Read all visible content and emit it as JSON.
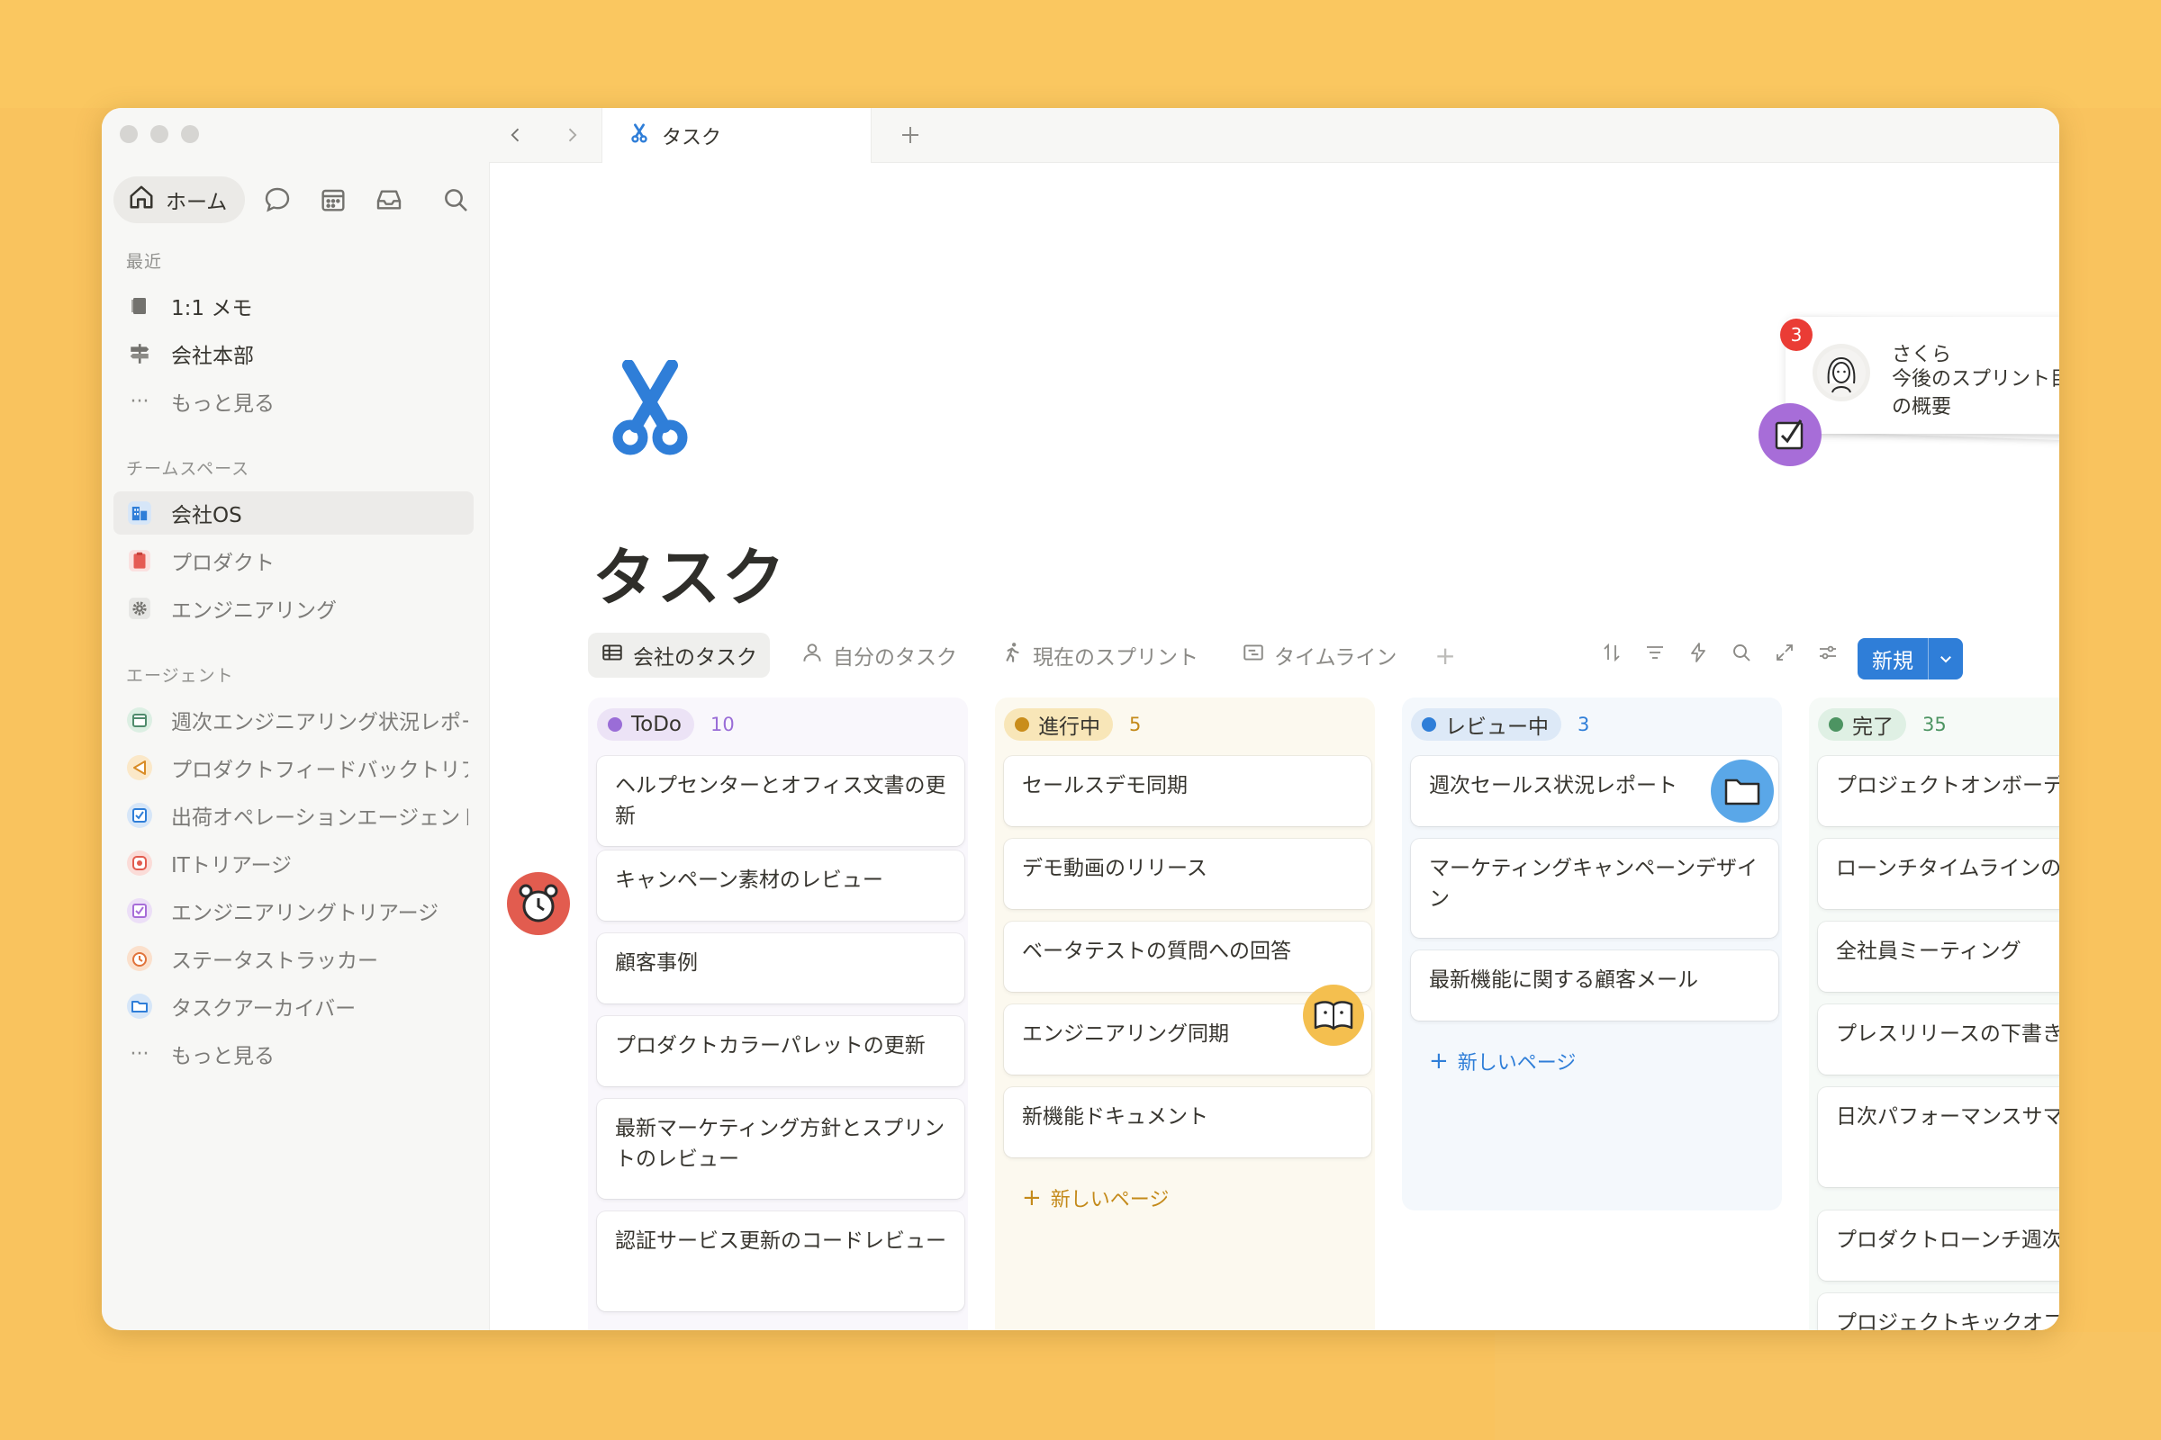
{
  "sidebar": {
    "home_label": "ホーム",
    "recent_label": "最近",
    "recent": [
      {
        "label": "1:1 メモ",
        "icon": "document-icon"
      },
      {
        "label": "会社本部",
        "icon": "signpost-icon"
      },
      {
        "label": "もっと見る",
        "icon": "ellipsis-icon"
      }
    ],
    "teamspace_label": "チームスペース",
    "teamspaces": [
      {
        "label": "会社OS",
        "icon": "building-icon"
      },
      {
        "label": "プロダクト",
        "icon": "clipboard-icon"
      },
      {
        "label": "エンジニアリング",
        "icon": "gear-icon"
      }
    ],
    "agents_label": "エージェント",
    "agents": [
      {
        "label": "週次エンジニアリング状況レポート",
        "icon": "calendar-agent-icon",
        "color": "#4f8b6c"
      },
      {
        "label": "プロダクトフィードバックトリアージ",
        "icon": "megaphone-agent-icon",
        "color": "#d98c26"
      },
      {
        "label": "出荷オペレーションエージェント",
        "icon": "checkbox-agent-icon",
        "color": "#2f7ed8"
      },
      {
        "label": "ITトリアージ",
        "icon": "lifebuoy-agent-icon",
        "color": "#e25c4f"
      },
      {
        "label": "エンジニアリングトリアージ",
        "icon": "check-agent-icon",
        "color": "#a76dd8"
      },
      {
        "label": "ステータストラッカー",
        "icon": "alarm-agent-icon",
        "color": "#e0733b"
      },
      {
        "label": "タスクアーカイバー",
        "icon": "folder-agent-icon",
        "color": "#2f7ed8"
      },
      {
        "label": "もっと見る",
        "icon": "ellipsis-icon"
      }
    ]
  },
  "tabbar": {
    "tab_label": "タスク"
  },
  "page": {
    "title": "タスク"
  },
  "views": [
    {
      "label": "会社のタスク",
      "icon": "table-icon"
    },
    {
      "label": "自分のタスク",
      "icon": "person-icon"
    },
    {
      "label": "現在のスプリント",
      "icon": "runner-icon"
    },
    {
      "label": "タイムライン",
      "icon": "timeline-icon"
    }
  ],
  "toolbar": {
    "new_label": "新規"
  },
  "board": {
    "add_page_label": "新しいページ",
    "columns": [
      {
        "label": "ToDo",
        "count": "10",
        "dot": "#9a6dd7",
        "pill_bg": "#ece3f6",
        "count_color": "#9a6dd7",
        "col_bg": "#f9f7fc",
        "cards": [
          "ヘルプセンターとオフィス文書の更新",
          "キャンペーン素材のレビュー",
          "顧客事例",
          "プロダクトカラーパレットの更新",
          "最新マーケティング方針とスプリントのレビュー",
          "認証サービス更新のコードレビュー"
        ]
      },
      {
        "label": "進行中",
        "count": "5",
        "dot": "#c98d1b",
        "pill_bg": "#f8e6b8",
        "count_color": "#c48a1a",
        "col_bg": "#fcf9ef",
        "cards": [
          "セールスデモ同期",
          "デモ動画のリリース",
          "ベータテストの質問への回答",
          "エンジニアリング同期",
          "新機能ドキュメント"
        ]
      },
      {
        "label": "レビュー中",
        "count": "3",
        "dot": "#2f7ed8",
        "pill_bg": "#dde9f7",
        "count_color": "#2f7ed8",
        "col_bg": "#f4f8fc",
        "cards": [
          "週次セールス状況レポート",
          "マーケティングキャンペーンデザイン",
          "最新機能に関する顧客メール"
        ]
      },
      {
        "label": "完了",
        "count": "35",
        "dot": "#4d9462",
        "pill_bg": "#dff0e4",
        "count_color": "#4d9462",
        "col_bg": "#f6faf7",
        "cards": [
          "プロジェクトオンボーディング",
          "ローンチタイムラインの確定",
          "全社員ミーティング",
          "プレスリリースの下書き",
          "日次パフォーマンスサマリーレポート",
          "プロダクトローンチ週次",
          "プロジェクトキックオフ"
        ]
      }
    ]
  },
  "notification": {
    "count": "3",
    "name": "さくら",
    "message": "今後のスプリント目標の概要"
  }
}
